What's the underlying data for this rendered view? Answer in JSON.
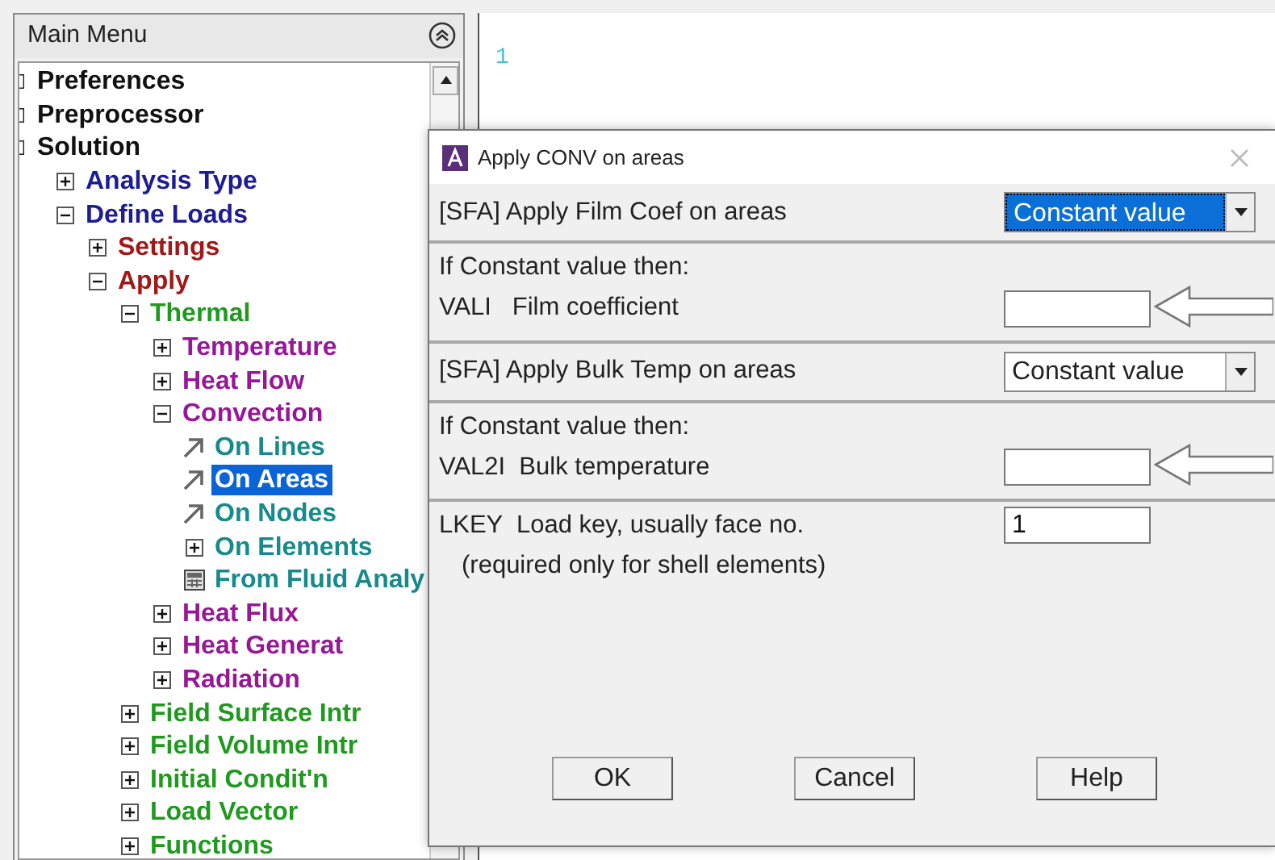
{
  "main_menu": {
    "title": "Main Menu",
    "tree": [
      {
        "label": "Preferences",
        "kind": "clipped",
        "color": "#111111",
        "selected": false
      },
      {
        "label": "Preprocessor",
        "kind": "clipped",
        "color": "#111111",
        "selected": false
      },
      {
        "label": "Solution",
        "kind": "clipped",
        "color": "#111111",
        "selected": false,
        "children": [
          {
            "label": "Analysis Type",
            "kind": "toggle",
            "expanded": false,
            "color": "#1c1c96",
            "selected": false
          },
          {
            "label": "Define Loads",
            "kind": "toggle",
            "expanded": true,
            "color": "#1c1c96",
            "selected": false,
            "children": [
              {
                "label": "Settings",
                "kind": "toggle",
                "expanded": false,
                "color": "#a01818",
                "selected": false
              },
              {
                "label": "Apply",
                "kind": "toggle",
                "expanded": true,
                "color": "#a01818",
                "selected": false,
                "children": [
                  {
                    "label": "Thermal",
                    "kind": "toggle",
                    "expanded": true,
                    "color": "#1f9a1f",
                    "selected": false,
                    "children": [
                      {
                        "label": "Temperature",
                        "kind": "toggle",
                        "expanded": false,
                        "color": "#961896",
                        "selected": false
                      },
                      {
                        "label": "Heat Flow",
                        "kind": "toggle",
                        "expanded": false,
                        "color": "#961896",
                        "selected": false
                      },
                      {
                        "label": "Convection",
                        "kind": "toggle",
                        "expanded": true,
                        "color": "#961896",
                        "selected": false,
                        "children": [
                          {
                            "label": "On Lines",
                            "kind": "command",
                            "color": "#178a8a",
                            "selected": false
                          },
                          {
                            "label": "On Areas",
                            "kind": "command",
                            "selected": true
                          },
                          {
                            "label": "On Nodes",
                            "kind": "command",
                            "color": "#178a8a",
                            "selected": false
                          },
                          {
                            "label": "On Elements",
                            "kind": "toggle",
                            "expanded": false,
                            "color": "#178a8a",
                            "selected": false
                          },
                          {
                            "label": "From Fluid Analy",
                            "kind": "table",
                            "color": "#178a8a",
                            "selected": false
                          }
                        ]
                      },
                      {
                        "label": "Heat Flux",
                        "kind": "toggle",
                        "expanded": false,
                        "color": "#961896",
                        "selected": false
                      },
                      {
                        "label": "Heat Generat",
                        "kind": "toggle",
                        "expanded": false,
                        "color": "#961896",
                        "selected": false
                      },
                      {
                        "label": "Radiation",
                        "kind": "toggle",
                        "expanded": false,
                        "color": "#961896",
                        "selected": false
                      }
                    ]
                  },
                  {
                    "label": "Field Surface Intr",
                    "kind": "toggle",
                    "expanded": false,
                    "color": "#1f9a1f",
                    "selected": false
                  },
                  {
                    "label": "Field Volume Intr",
                    "kind": "toggle",
                    "expanded": false,
                    "color": "#1f9a1f",
                    "selected": false
                  },
                  {
                    "label": "Initial Condit'n",
                    "kind": "toggle",
                    "expanded": false,
                    "color": "#1f9a1f",
                    "selected": false
                  },
                  {
                    "label": "Load Vector",
                    "kind": "toggle",
                    "expanded": false,
                    "color": "#1f9a1f",
                    "selected": false
                  },
                  {
                    "label": "Functions",
                    "kind": "toggle",
                    "expanded": false,
                    "color": "#1f9a1f",
                    "selected": false
                  }
                ]
              }
            ]
          }
        ]
      }
    ]
  },
  "output_window": {
    "line_number": "1"
  },
  "dialog": {
    "title": "Apply CONV on areas",
    "rows": [
      {
        "kind": "select",
        "label": "[SFA] Apply Film Coef on areas",
        "value": "Constant value",
        "focused": true
      },
      {
        "kind": "input",
        "caption": "If Constant value then:",
        "label": "VALI   Film coefficient",
        "pointer": true
      },
      {
        "kind": "select",
        "label": "[SFA] Apply Bulk Temp on areas",
        "value": "Constant value",
        "focused": false
      },
      {
        "kind": "input",
        "caption": "If Constant value then:",
        "label": "VAL2I  Bulk temperature",
        "pointer": true
      },
      {
        "kind": "input",
        "label": "LKEY  Load key, usually face no.",
        "value": "1",
        "note": "(required only for shell elements)",
        "pointer": false
      }
    ],
    "buttons": [
      "OK",
      "Cancel",
      "Help"
    ]
  }
}
